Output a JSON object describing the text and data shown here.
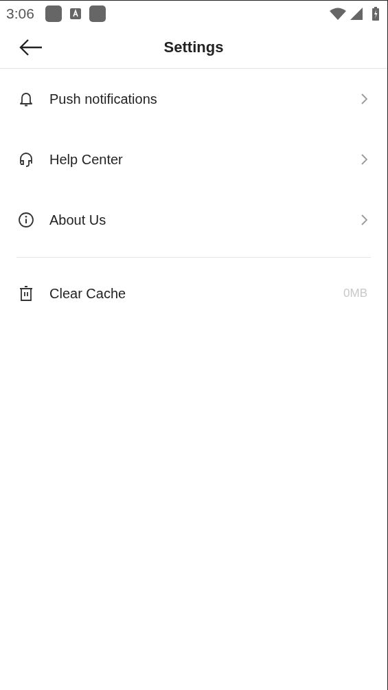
{
  "status_bar": {
    "time": "3:06"
  },
  "header": {
    "title": "Settings"
  },
  "groups": [
    {
      "items": [
        {
          "kind": "link",
          "label": "Push notifications"
        },
        {
          "kind": "link",
          "label": "Help Center"
        },
        {
          "kind": "link",
          "label": "About Us"
        }
      ]
    },
    {
      "items": [
        {
          "kind": "value",
          "label": "Clear Cache",
          "value": "0MB"
        }
      ]
    }
  ]
}
